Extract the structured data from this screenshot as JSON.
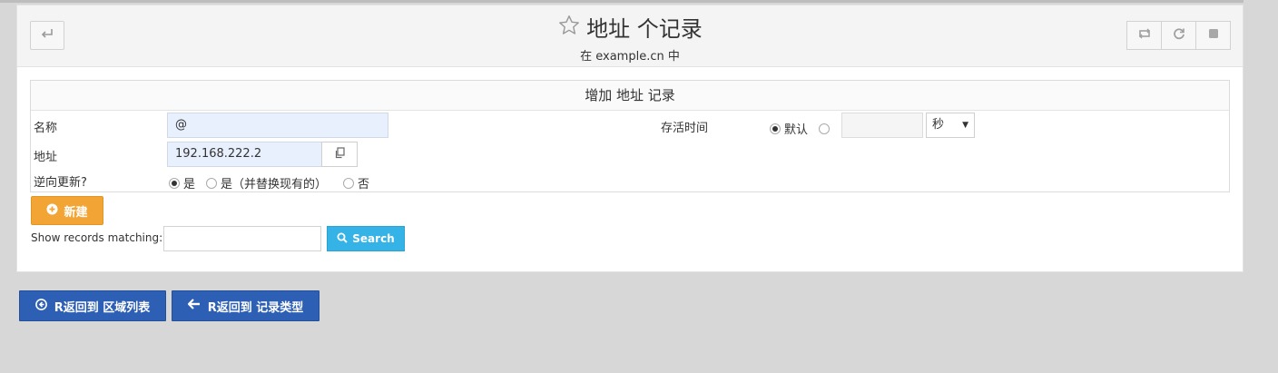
{
  "header": {
    "title": "地址 个记录",
    "subtitle": "在 example.cn 中",
    "back_icon": "undo-arrow-icon",
    "right_icons": [
      "refresh-pair-icon",
      "reload-icon",
      "stop-icon"
    ]
  },
  "form": {
    "title": "增加 地址 记录",
    "name_label": "名称",
    "name_value": "@",
    "address_label": "地址",
    "address_value": "192.168.222.2",
    "reverse_label": "逆向更新?",
    "reverse_options": [
      "是",
      "是（并替换现有的）",
      "否"
    ],
    "reverse_selected": 0,
    "ttl_label": "存活时间",
    "ttl_default_label": "默认",
    "ttl_default_selected": true,
    "ttl_value": "",
    "ttl_unit": "秒"
  },
  "actions": {
    "new_label": "新建",
    "show_matching_label": "Show records matching:",
    "search_value": "",
    "search_label": "Search"
  },
  "footer": {
    "back_zones_label": "R返回到 区域列表",
    "back_types_label": "R返回到 记录类型"
  },
  "colors": {
    "accent_orange": "#f2a534",
    "search_blue": "#35b2e6",
    "nav_blue": "#2d5fb4"
  }
}
